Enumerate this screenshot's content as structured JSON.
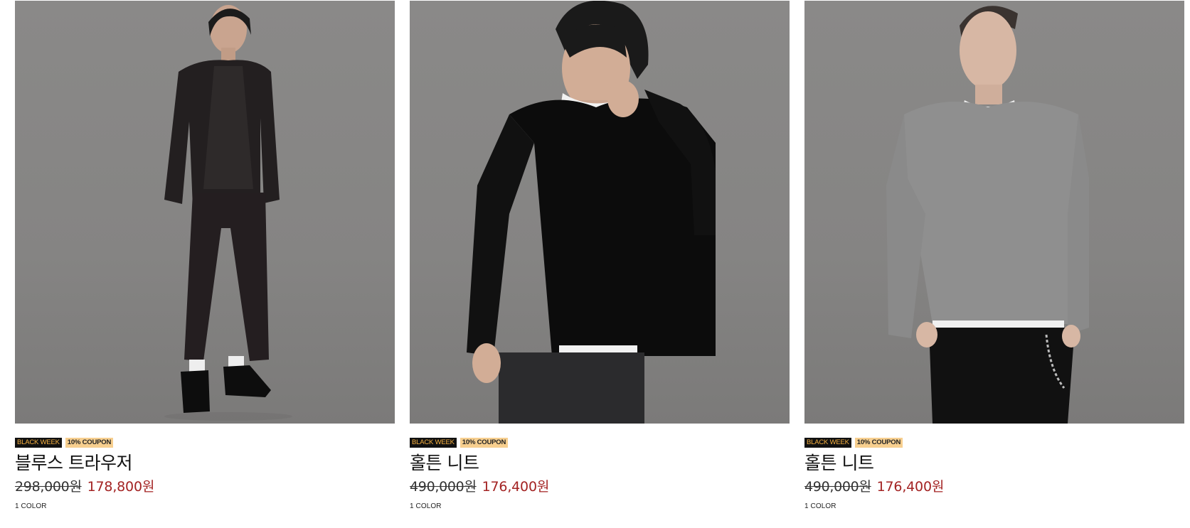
{
  "products": [
    {
      "badges": {
        "black_week": "BLACK WEEK",
        "coupon": "10% COUPON"
      },
      "name": "블루스 트라우저",
      "original_price": "298,000원",
      "sale_price": "178,800원",
      "colors": "1 COLOR"
    },
    {
      "badges": {
        "black_week": "BLACK WEEK",
        "coupon": "10% COUPON"
      },
      "name": "홀튼 니트",
      "original_price": "490,000원",
      "sale_price": "176,400원",
      "colors": "1 COLOR"
    },
    {
      "badges": {
        "black_week": "BLACK WEEK",
        "coupon": "10% COUPON"
      },
      "name": "홀튼 니트",
      "original_price": "490,000원",
      "sale_price": "176,400원",
      "colors": "1 COLOR"
    }
  ],
  "colors": {
    "photo_background": "#858483",
    "badge_black": "#111111",
    "badge_black_text": "#f5b041",
    "badge_coupon": "#f7cf8f",
    "sale_price": "#a32323"
  }
}
